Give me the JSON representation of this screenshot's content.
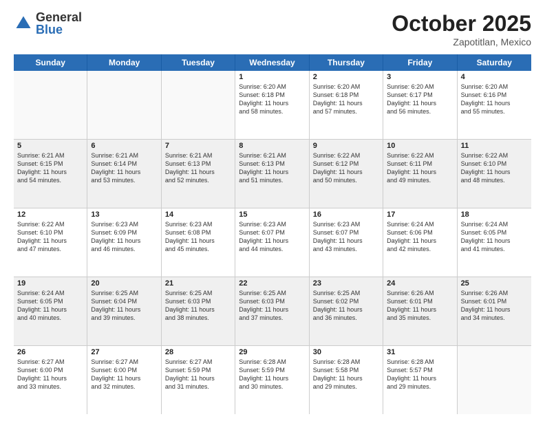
{
  "logo": {
    "general": "General",
    "blue": "Blue"
  },
  "title": "October 2025",
  "location": "Zapotitlan, Mexico",
  "header_days": [
    "Sunday",
    "Monday",
    "Tuesday",
    "Wednesday",
    "Thursday",
    "Friday",
    "Saturday"
  ],
  "weeks": [
    [
      {
        "day": "",
        "empty": true
      },
      {
        "day": "",
        "empty": true
      },
      {
        "day": "",
        "empty": true
      },
      {
        "day": "1",
        "lines": [
          "Sunrise: 6:20 AM",
          "Sunset: 6:18 PM",
          "Daylight: 11 hours",
          "and 58 minutes."
        ]
      },
      {
        "day": "2",
        "lines": [
          "Sunrise: 6:20 AM",
          "Sunset: 6:18 PM",
          "Daylight: 11 hours",
          "and 57 minutes."
        ]
      },
      {
        "day": "3",
        "lines": [
          "Sunrise: 6:20 AM",
          "Sunset: 6:17 PM",
          "Daylight: 11 hours",
          "and 56 minutes."
        ]
      },
      {
        "day": "4",
        "lines": [
          "Sunrise: 6:20 AM",
          "Sunset: 6:16 PM",
          "Daylight: 11 hours",
          "and 55 minutes."
        ]
      }
    ],
    [
      {
        "day": "5",
        "lines": [
          "Sunrise: 6:21 AM",
          "Sunset: 6:15 PM",
          "Daylight: 11 hours",
          "and 54 minutes."
        ]
      },
      {
        "day": "6",
        "lines": [
          "Sunrise: 6:21 AM",
          "Sunset: 6:14 PM",
          "Daylight: 11 hours",
          "and 53 minutes."
        ]
      },
      {
        "day": "7",
        "lines": [
          "Sunrise: 6:21 AM",
          "Sunset: 6:13 PM",
          "Daylight: 11 hours",
          "and 52 minutes."
        ]
      },
      {
        "day": "8",
        "lines": [
          "Sunrise: 6:21 AM",
          "Sunset: 6:13 PM",
          "Daylight: 11 hours",
          "and 51 minutes."
        ]
      },
      {
        "day": "9",
        "lines": [
          "Sunrise: 6:22 AM",
          "Sunset: 6:12 PM",
          "Daylight: 11 hours",
          "and 50 minutes."
        ]
      },
      {
        "day": "10",
        "lines": [
          "Sunrise: 6:22 AM",
          "Sunset: 6:11 PM",
          "Daylight: 11 hours",
          "and 49 minutes."
        ]
      },
      {
        "day": "11",
        "lines": [
          "Sunrise: 6:22 AM",
          "Sunset: 6:10 PM",
          "Daylight: 11 hours",
          "and 48 minutes."
        ]
      }
    ],
    [
      {
        "day": "12",
        "lines": [
          "Sunrise: 6:22 AM",
          "Sunset: 6:10 PM",
          "Daylight: 11 hours",
          "and 47 minutes."
        ]
      },
      {
        "day": "13",
        "lines": [
          "Sunrise: 6:23 AM",
          "Sunset: 6:09 PM",
          "Daylight: 11 hours",
          "and 46 minutes."
        ]
      },
      {
        "day": "14",
        "lines": [
          "Sunrise: 6:23 AM",
          "Sunset: 6:08 PM",
          "Daylight: 11 hours",
          "and 45 minutes."
        ]
      },
      {
        "day": "15",
        "lines": [
          "Sunrise: 6:23 AM",
          "Sunset: 6:07 PM",
          "Daylight: 11 hours",
          "and 44 minutes."
        ]
      },
      {
        "day": "16",
        "lines": [
          "Sunrise: 6:23 AM",
          "Sunset: 6:07 PM",
          "Daylight: 11 hours",
          "and 43 minutes."
        ]
      },
      {
        "day": "17",
        "lines": [
          "Sunrise: 6:24 AM",
          "Sunset: 6:06 PM",
          "Daylight: 11 hours",
          "and 42 minutes."
        ]
      },
      {
        "day": "18",
        "lines": [
          "Sunrise: 6:24 AM",
          "Sunset: 6:05 PM",
          "Daylight: 11 hours",
          "and 41 minutes."
        ]
      }
    ],
    [
      {
        "day": "19",
        "lines": [
          "Sunrise: 6:24 AM",
          "Sunset: 6:05 PM",
          "Daylight: 11 hours",
          "and 40 minutes."
        ]
      },
      {
        "day": "20",
        "lines": [
          "Sunrise: 6:25 AM",
          "Sunset: 6:04 PM",
          "Daylight: 11 hours",
          "and 39 minutes."
        ]
      },
      {
        "day": "21",
        "lines": [
          "Sunrise: 6:25 AM",
          "Sunset: 6:03 PM",
          "Daylight: 11 hours",
          "and 38 minutes."
        ]
      },
      {
        "day": "22",
        "lines": [
          "Sunrise: 6:25 AM",
          "Sunset: 6:03 PM",
          "Daylight: 11 hours",
          "and 37 minutes."
        ]
      },
      {
        "day": "23",
        "lines": [
          "Sunrise: 6:25 AM",
          "Sunset: 6:02 PM",
          "Daylight: 11 hours",
          "and 36 minutes."
        ]
      },
      {
        "day": "24",
        "lines": [
          "Sunrise: 6:26 AM",
          "Sunset: 6:01 PM",
          "Daylight: 11 hours",
          "and 35 minutes."
        ]
      },
      {
        "day": "25",
        "lines": [
          "Sunrise: 6:26 AM",
          "Sunset: 6:01 PM",
          "Daylight: 11 hours",
          "and 34 minutes."
        ]
      }
    ],
    [
      {
        "day": "26",
        "lines": [
          "Sunrise: 6:27 AM",
          "Sunset: 6:00 PM",
          "Daylight: 11 hours",
          "and 33 minutes."
        ]
      },
      {
        "day": "27",
        "lines": [
          "Sunrise: 6:27 AM",
          "Sunset: 6:00 PM",
          "Daylight: 11 hours",
          "and 32 minutes."
        ]
      },
      {
        "day": "28",
        "lines": [
          "Sunrise: 6:27 AM",
          "Sunset: 5:59 PM",
          "Daylight: 11 hours",
          "and 31 minutes."
        ]
      },
      {
        "day": "29",
        "lines": [
          "Sunrise: 6:28 AM",
          "Sunset: 5:59 PM",
          "Daylight: 11 hours",
          "and 30 minutes."
        ]
      },
      {
        "day": "30",
        "lines": [
          "Sunrise: 6:28 AM",
          "Sunset: 5:58 PM",
          "Daylight: 11 hours",
          "and 29 minutes."
        ]
      },
      {
        "day": "31",
        "lines": [
          "Sunrise: 6:28 AM",
          "Sunset: 5:57 PM",
          "Daylight: 11 hours",
          "and 29 minutes."
        ]
      },
      {
        "day": "",
        "empty": true
      }
    ]
  ]
}
